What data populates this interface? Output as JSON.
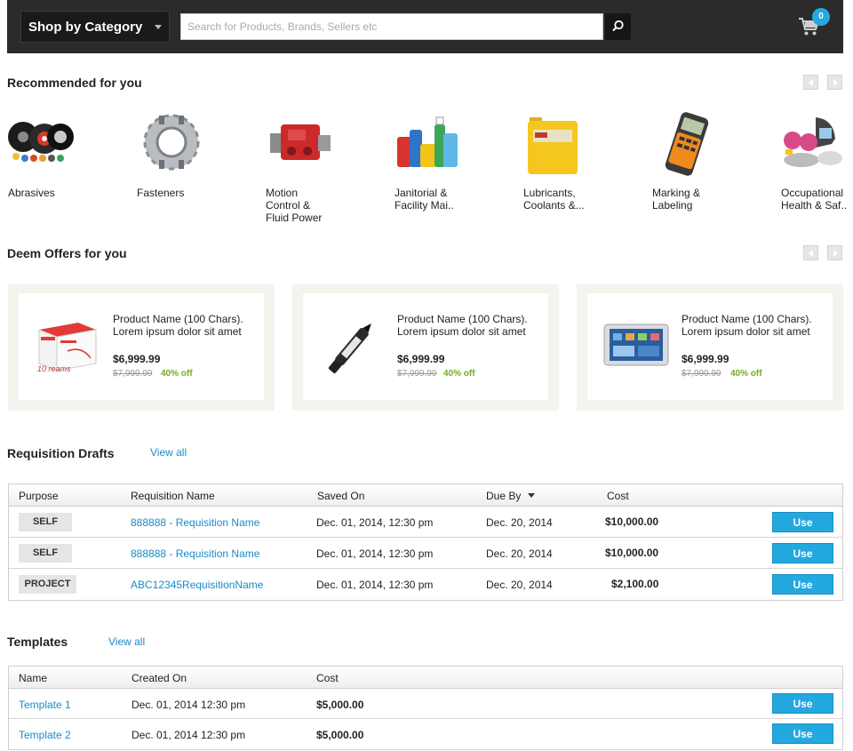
{
  "header": {
    "category_label": "Shop by Category",
    "search_placeholder": "Search for Products, Brands, Sellers etc",
    "cart_count": "0"
  },
  "recommended": {
    "title": "Recommended for you",
    "items": [
      {
        "label": "Abrasives"
      },
      {
        "label": "Fasteners"
      },
      {
        "label": "Motion Control & Fluid Power"
      },
      {
        "label": "Janitorial & Facility Mai.."
      },
      {
        "label": "Lubricants, Coolants &..."
      },
      {
        "label": "Marking & Labeling"
      },
      {
        "label": "Occupational Health & Saf.."
      }
    ]
  },
  "offers": {
    "title": "Deem Offers for you",
    "box_text": "10 reams",
    "items": [
      {
        "name": "Product Name (100 Chars). Lorem ipsum dolor sit amet",
        "price": "$6,999.99",
        "old_price": "$7,999.99",
        "discount": "40% off"
      },
      {
        "name": "Product Name (100 Chars). Lorem ipsum dolor sit amet",
        "price": "$6,999.99",
        "old_price": "$7,999.99",
        "discount": "40% off"
      },
      {
        "name": "Product Name (100 Chars). Lorem ipsum dolor sit amet",
        "price": "$6,999.99",
        "old_price": "$7,999.99",
        "discount": "40% off"
      }
    ]
  },
  "drafts": {
    "title": "Requisition Drafts",
    "view_all": "View all",
    "columns": [
      "Purpose",
      "Requisition Name",
      "Saved On",
      "Due By",
      "Cost"
    ],
    "rows": [
      {
        "purpose": "SELF",
        "name": "888888 - Requisition Name",
        "saved_on": "Dec. 01, 2014, 12:30 pm",
        "due_by": "Dec. 20, 2014",
        "cost": "$10,000.00",
        "action": "Use"
      },
      {
        "purpose": "SELF",
        "name": "888888 - Requisition Name",
        "saved_on": "Dec. 01, 2014, 12:30 pm",
        "due_by": "Dec. 20, 2014",
        "cost": "$10,000.00",
        "action": "Use"
      },
      {
        "purpose": "PROJECT",
        "name": "ABC12345RequisitionName",
        "saved_on": "Dec. 01, 2014, 12:30 pm",
        "due_by": "Dec. 20, 2014",
        "cost": "$2,100.00",
        "action": "Use"
      }
    ]
  },
  "templates": {
    "title": "Templates",
    "view_all": "View all",
    "columns": [
      "Name",
      "Created On",
      "Cost"
    ],
    "rows": [
      {
        "name": "Template 1",
        "created_on": "Dec. 01, 2014 12:30 pm",
        "cost": "$5,000.00",
        "action": "Use"
      },
      {
        "name": "Template 2",
        "created_on": "Dec. 01, 2014 12:30 pm",
        "cost": "$5,000.00",
        "action": "Use"
      }
    ]
  },
  "colors": {
    "header_bg": "#2b2b2b",
    "accent_blue": "#24a8e0",
    "link_blue": "#1a8bc7",
    "discount_green": "#6fae1e"
  }
}
